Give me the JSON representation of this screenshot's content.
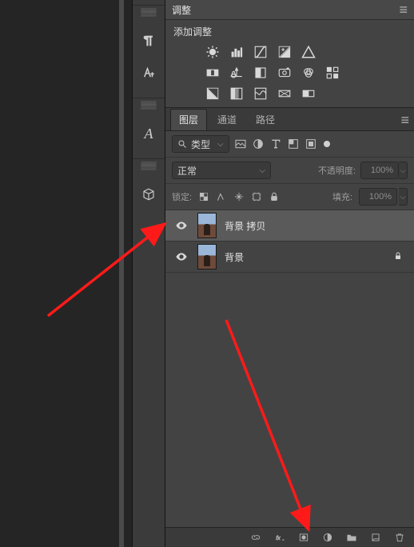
{
  "adjustments": {
    "title": "调整",
    "subtitle": "添加调整"
  },
  "layers_panel": {
    "tabs": [
      "图层",
      "通道",
      "路径"
    ]
  },
  "filter": {
    "mode_label": "类型"
  },
  "blend": {
    "mode": "正常",
    "opacity_label": "不透明度:",
    "opacity_value": "100%"
  },
  "lock": {
    "label": "锁定:",
    "fill_label": "填充:",
    "fill_value": "100%"
  },
  "layers": [
    {
      "name": "背景 拷贝"
    },
    {
      "name": "背景"
    }
  ]
}
